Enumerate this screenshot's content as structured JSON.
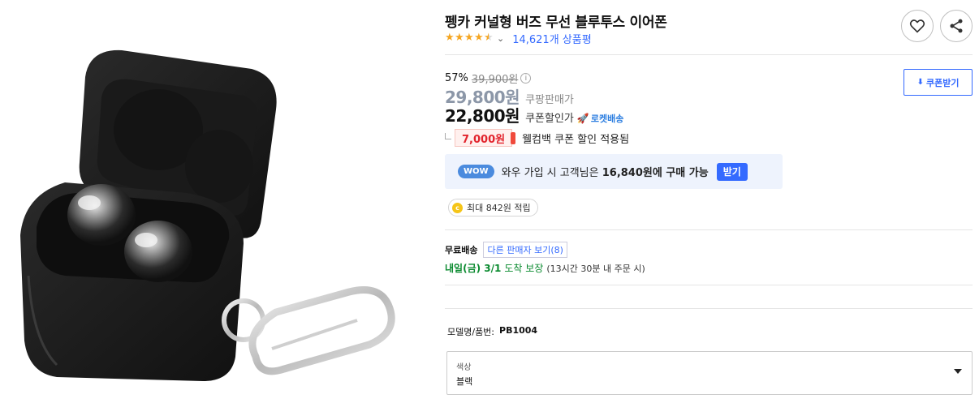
{
  "product": {
    "title": "펭카 커널형 버즈 무선 블루투스 이어폰",
    "rating": 4.5,
    "review_count": "14,621개 상품평",
    "image_alt": "earbuds-in-black-case-with-carabiner"
  },
  "pricing": {
    "discount_rate": "57%",
    "original_price": "39,900원",
    "info_glyph": "i",
    "sale_price": "29,800원",
    "sale_label": "쿠팡판매가",
    "coupon_price": "22,800원",
    "coupon_label": "쿠폰할인가",
    "rocket_label": "로켓배송"
  },
  "coupon": {
    "welcome_amount": "7,000원",
    "welcome_text": "웰컴백 쿠폰 할인 적용됨",
    "download_label": "쿠폰받기"
  },
  "wow": {
    "badge": "WOW",
    "text_before": "와우 가입 시 고객님은 ",
    "text_price": "16,840원에 구매 가능",
    "button_label": "받기"
  },
  "points": {
    "coin_glyph": "c",
    "text": "최대 842원 적립"
  },
  "shipping": {
    "label": "무료배송",
    "other_sellers": "다른 판매자 보기(8)",
    "delivery_day": "내일(금) 3/1",
    "guarantee": "도착 보장",
    "note": "(13시간 30분 내 주문 시)"
  },
  "model": {
    "label": "모델명/품번:",
    "value": "PB1004"
  },
  "option": {
    "label": "색상",
    "value": "블랙"
  },
  "colors": {
    "accent_blue": "#346aff",
    "star": "#f5a623",
    "delivery_green": "#0a8a2f",
    "coupon_red": "#e2242d"
  }
}
